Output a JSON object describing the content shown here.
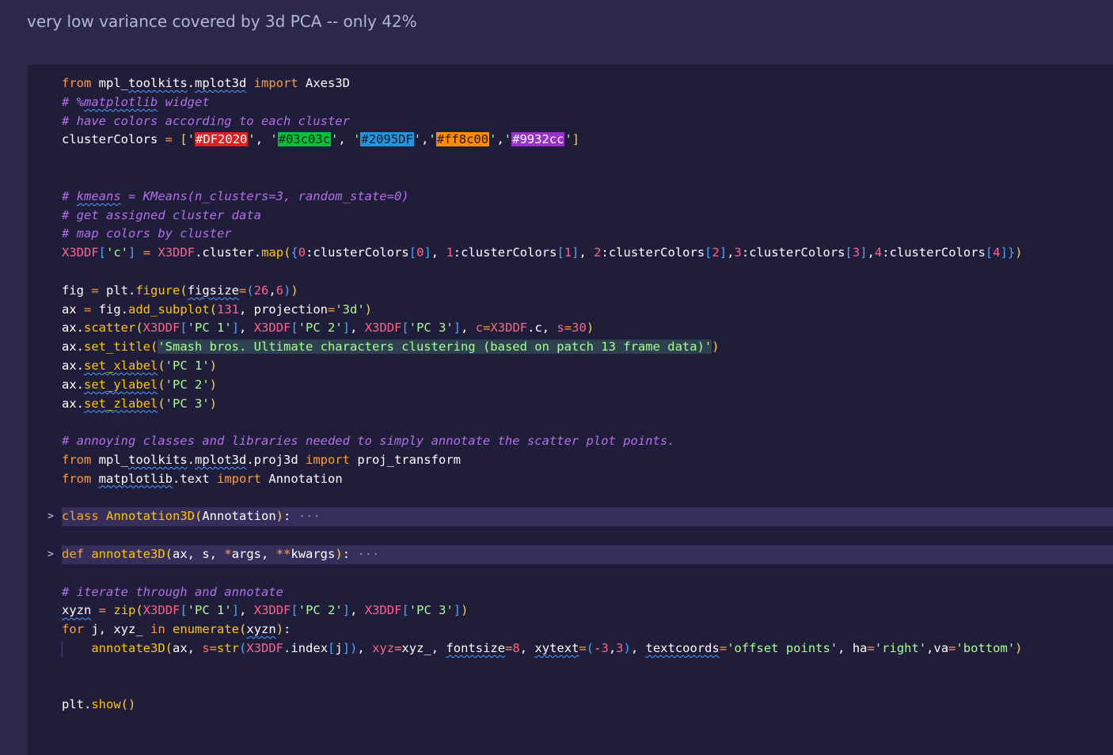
{
  "markdown": {
    "text": "very low variance covered by 3d PCA -- only 42%"
  },
  "colors": {
    "c0": "#DF2020",
    "c1": "#03c03c",
    "c2": "#2095DF",
    "c3": "#ff8c00",
    "c4": "#9932cc"
  },
  "code": {
    "title_string": "'Smash bros. Ultimate characters clustering (based on patch 13 frame data)'",
    "class_name": "Annotation3D",
    "func_name": "annotate3D",
    "ellipsis": "···"
  }
}
